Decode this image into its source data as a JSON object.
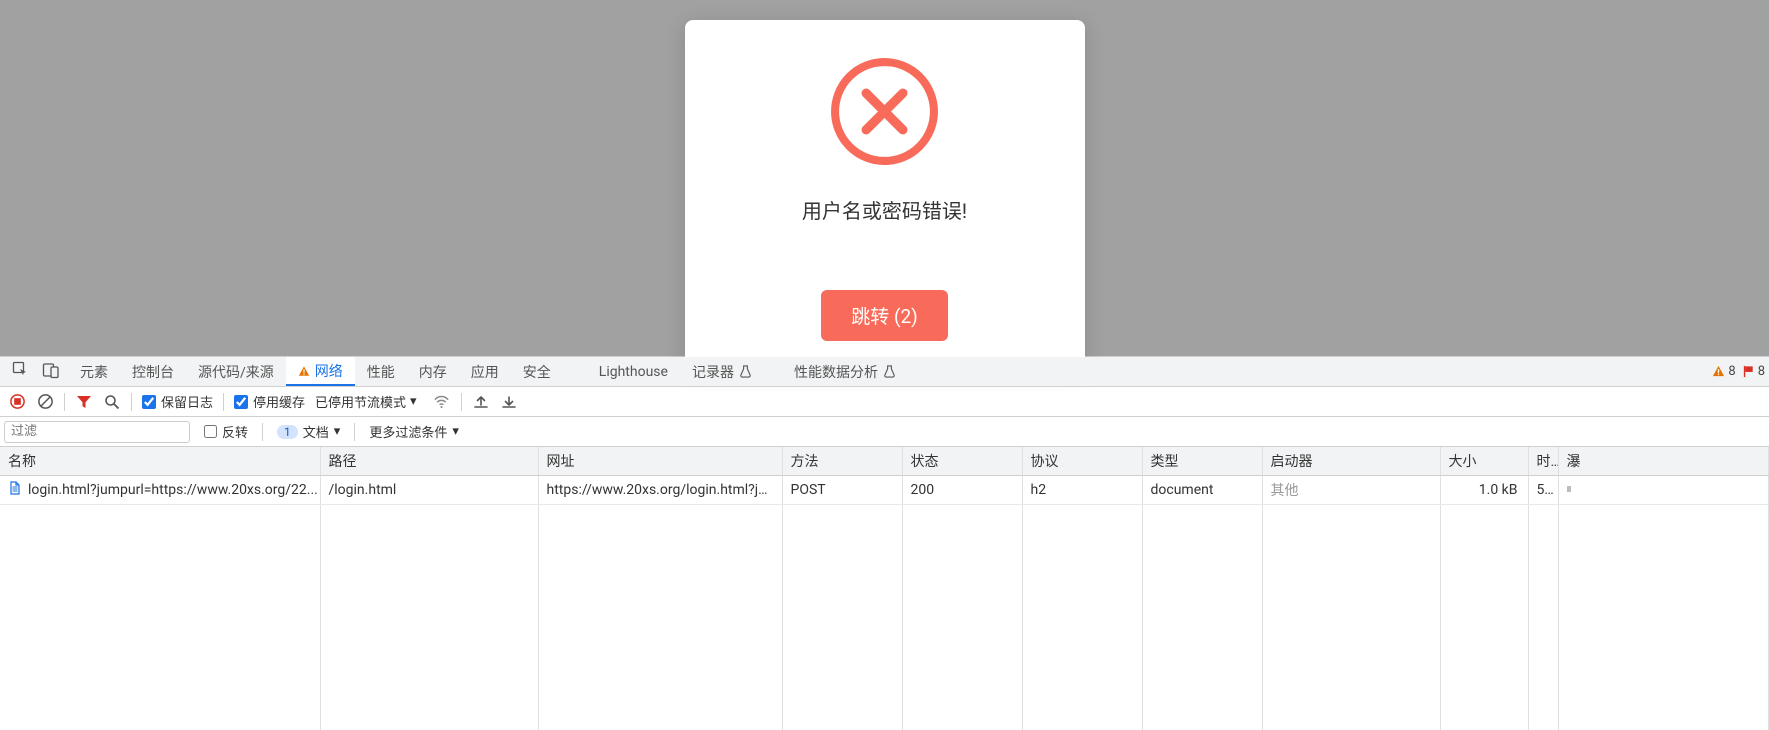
{
  "modal": {
    "error_message": "用户名或密码错误!",
    "button_label": "跳转 (2)"
  },
  "devtools": {
    "tabs": {
      "elements": "元素",
      "console": "控制台",
      "sources": "源代码/来源",
      "network": "网络",
      "performance": "性能",
      "memory": "内存",
      "application": "应用",
      "security": "安全",
      "lighthouse": "Lighthouse",
      "recorder": "记录器",
      "perf_insights": "性能数据分析"
    },
    "status": {
      "warnings": "8",
      "errors": "8"
    },
    "toolbar": {
      "preserve_log": "保留日志",
      "disable_cache": "停用缓存",
      "throttling": "已停用节流模式"
    },
    "filterbar": {
      "filter_placeholder": "过滤",
      "invert": "反转",
      "doc_count": "1",
      "doc_label": "文档",
      "more_filters": "更多过滤条件"
    },
    "table": {
      "headers": {
        "name": "名称",
        "path": "路径",
        "url": "网址",
        "method": "方法",
        "status": "状态",
        "protocol": "协议",
        "type": "类型",
        "initiator": "启动器",
        "size": "大小",
        "time": "时..",
        "waterfall": "瀑"
      },
      "rows": [
        {
          "name": "login.html?jumpurl=https://www.20xs.org/22...",
          "path": "/login.html",
          "url": "https://www.20xs.org/login.html?ju...",
          "method": "POST",
          "status": "200",
          "protocol": "h2",
          "type": "document",
          "initiator": "其他",
          "size": "1.0 kB",
          "time": "5..."
        }
      ]
    }
  }
}
